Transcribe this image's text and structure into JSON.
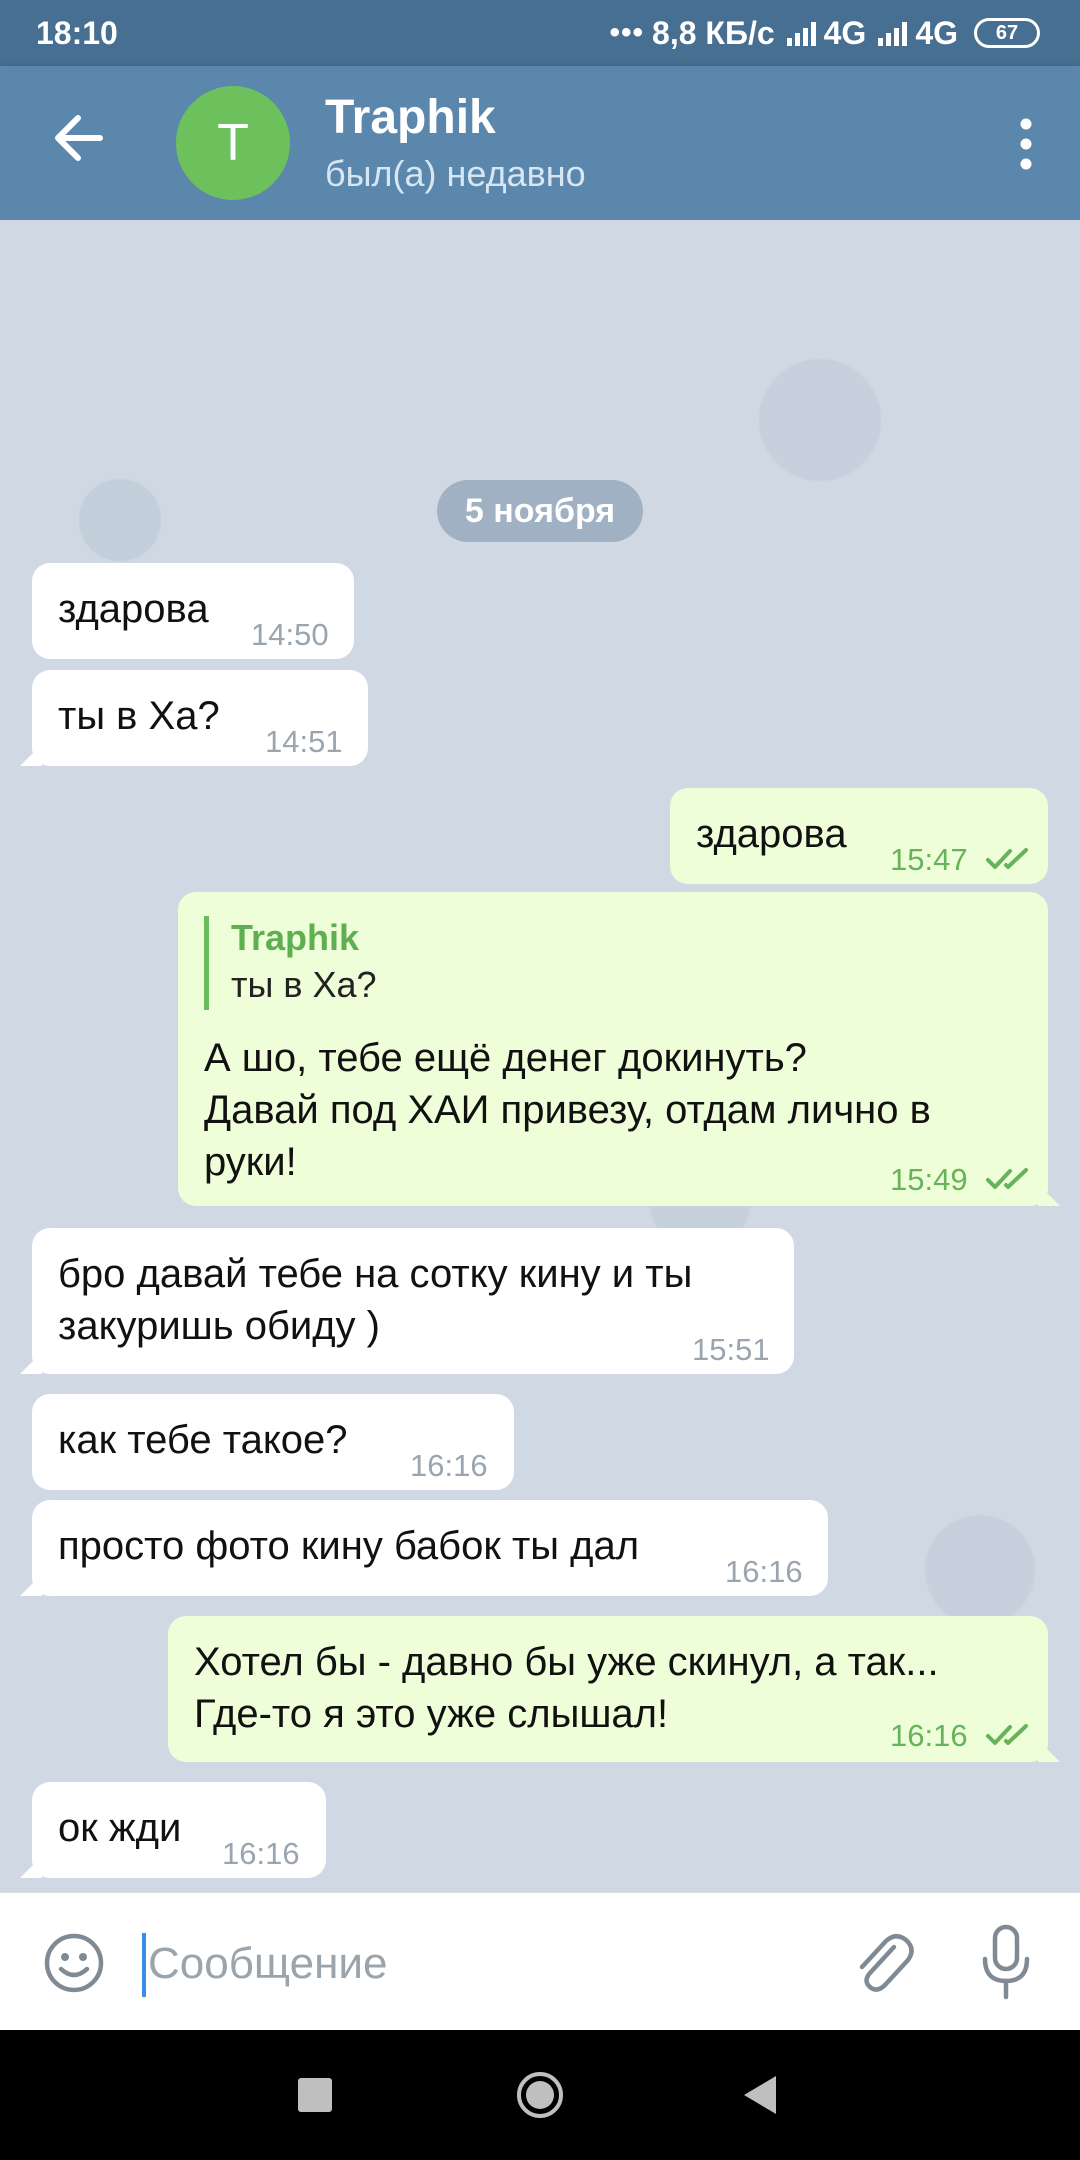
{
  "status_bar": {
    "time": "18:10",
    "dots": "•••",
    "network_speed": "8,8 КБ/с",
    "network_1": "4G",
    "network_2": "4G",
    "battery": "67"
  },
  "header": {
    "avatar_letter": "T",
    "avatar_color": "#6cc15c",
    "name": "Traphik",
    "status": "был(а) недавно",
    "back_icon": "arrow-left-icon",
    "menu_icon": "more-vertical-icon"
  },
  "chat": {
    "date_separator": "5 ноября",
    "messages": [
      {
        "direction": "in",
        "text": "здарова",
        "time": "14:50"
      },
      {
        "direction": "in",
        "text": "ты в Ха?",
        "time": "14:51"
      },
      {
        "direction": "out",
        "text": "здарова",
        "time": "15:47",
        "read": true
      },
      {
        "direction": "out",
        "reply_to": {
          "name": "Traphik",
          "text": "ты в Ха?"
        },
        "lines": [
          "А шо, тебе ещё денег докинуть?",
          "Давай под ХАИ привезу, отдам лично в",
          "руки!"
        ],
        "time": "15:49",
        "read": true
      },
      {
        "direction": "in",
        "lines": [
          "бро давай тебе на сотку кину и ты",
          "закуришь обиду )"
        ],
        "time": "15:51"
      },
      {
        "direction": "in",
        "text": "как тебе такое?",
        "time": "16:16"
      },
      {
        "direction": "in",
        "text": "просто фото кину бабок ты дал",
        "time": "16:16"
      },
      {
        "direction": "out",
        "lines": [
          "Хотел бы - давно бы уже скинул, а так...",
          "Где-то я это уже слышал!"
        ],
        "time": "16:16",
        "read": true
      },
      {
        "direction": "in",
        "text": "ок жди",
        "time": "16:16"
      }
    ]
  },
  "input_bar": {
    "placeholder": "Сообщение",
    "emoji_icon": "smile-icon",
    "attach_icon": "paperclip-icon",
    "mic_icon": "microphone-icon"
  },
  "colors": {
    "header": "#5b87ad",
    "status_bar": "#476f91",
    "outgoing_bubble": "#eefed8",
    "incoming_bubble": "#ffffff",
    "read_ticks": "#66b35a"
  }
}
